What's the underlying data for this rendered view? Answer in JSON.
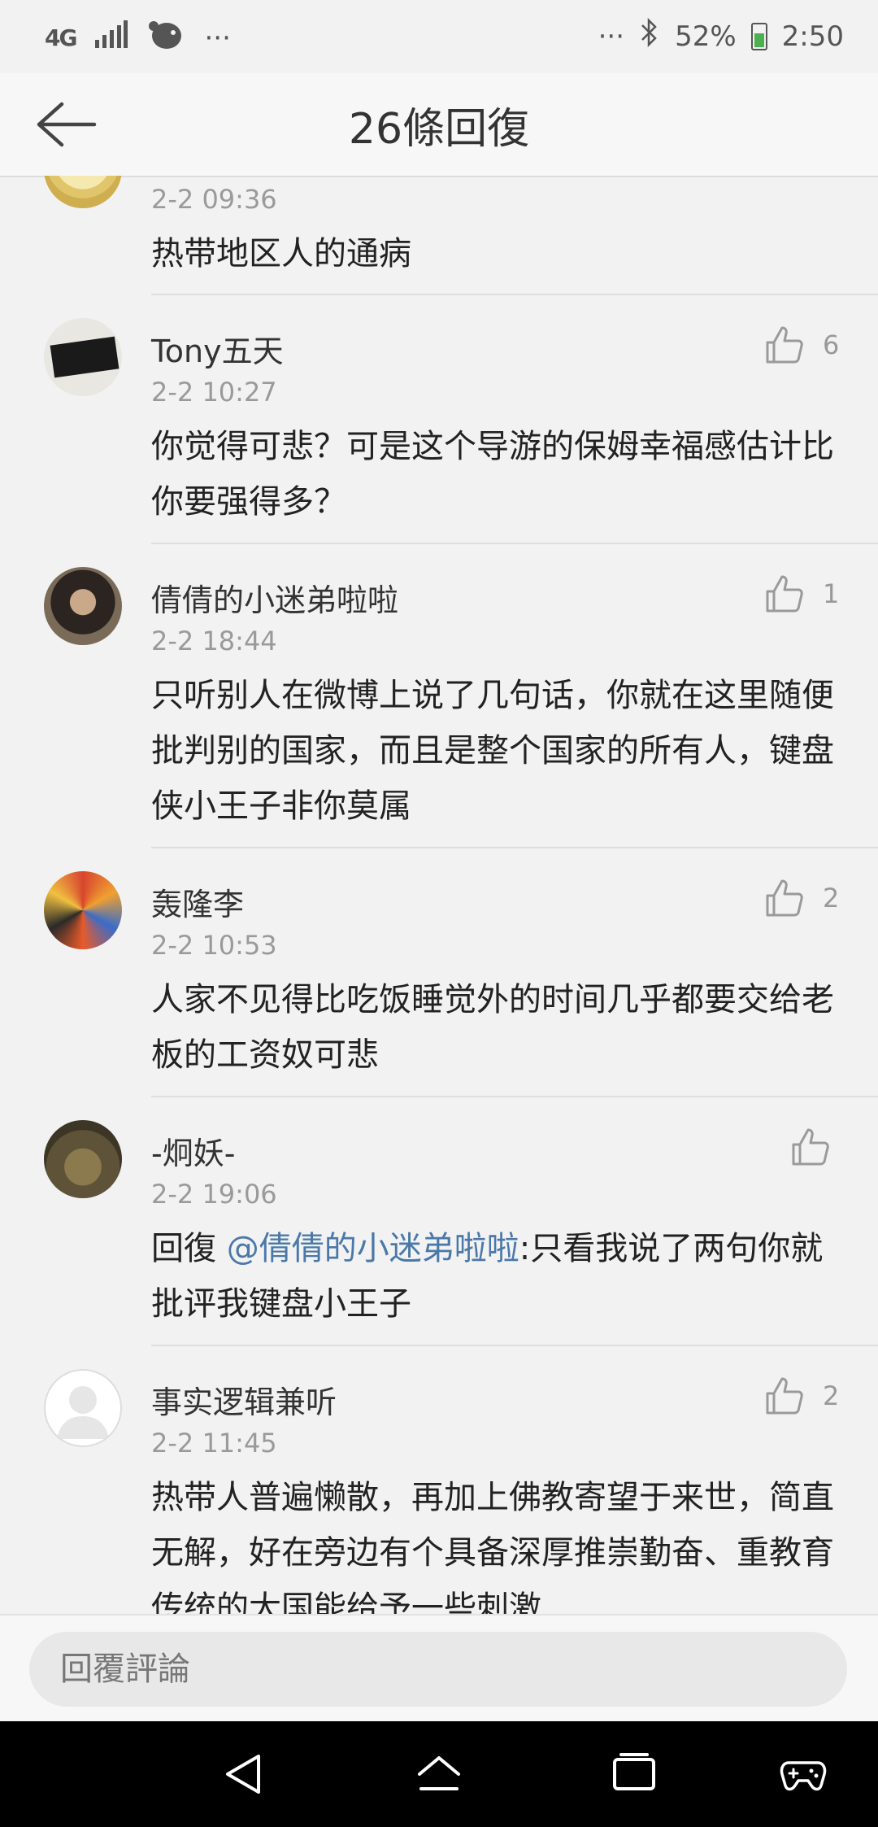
{
  "status_bar": {
    "network": "4G",
    "left_more": "···",
    "right_more": "···",
    "battery": "52%",
    "time": "2:50"
  },
  "header": {
    "title": "26條回復"
  },
  "comments": [
    {
      "time": "2-2 09:36",
      "text": "热带地区人的通病"
    },
    {
      "name": "Tony五天",
      "time": "2-2 10:27",
      "likes": "6",
      "text": "你觉得可悲？可是这个导游的保姆幸福感估计比你要强得多？"
    },
    {
      "name": "倩倩的小迷弟啦啦",
      "time": "2-2 18:44",
      "likes": "1",
      "text": "只听别人在微博上说了几句话，你就在这里随便批判别的国家，而且是整个国家的所有人，键盘侠小王子非你莫属"
    },
    {
      "name": "轰隆李",
      "time": "2-2 10:53",
      "likes": "2",
      "text": "人家不见得比吃饭睡觉外的时间几乎都要交给老板的工资奴可悲"
    },
    {
      "name": "-炯妖-",
      "time": "2-2 19:06",
      "reply_prefix": "回復 ",
      "mention": "@倩倩的小迷弟啦啦",
      "text": ":只看我说了两句你就批评我键盘小王子"
    },
    {
      "name": "事实逻辑兼听",
      "time": "2-2 11:45",
      "likes": "2",
      "text": "热带人普遍懒散，再加上佛教寄望于来世，简直无解，好在旁边有个具备深厚推崇勤奋、重教育传统的大国能给予一些刺激"
    }
  ],
  "reply_bar": {
    "placeholder": "回覆評論"
  },
  "colors": {
    "mention": "#4a78a8",
    "background": "#f2f2f2",
    "navbar": "#000000"
  }
}
